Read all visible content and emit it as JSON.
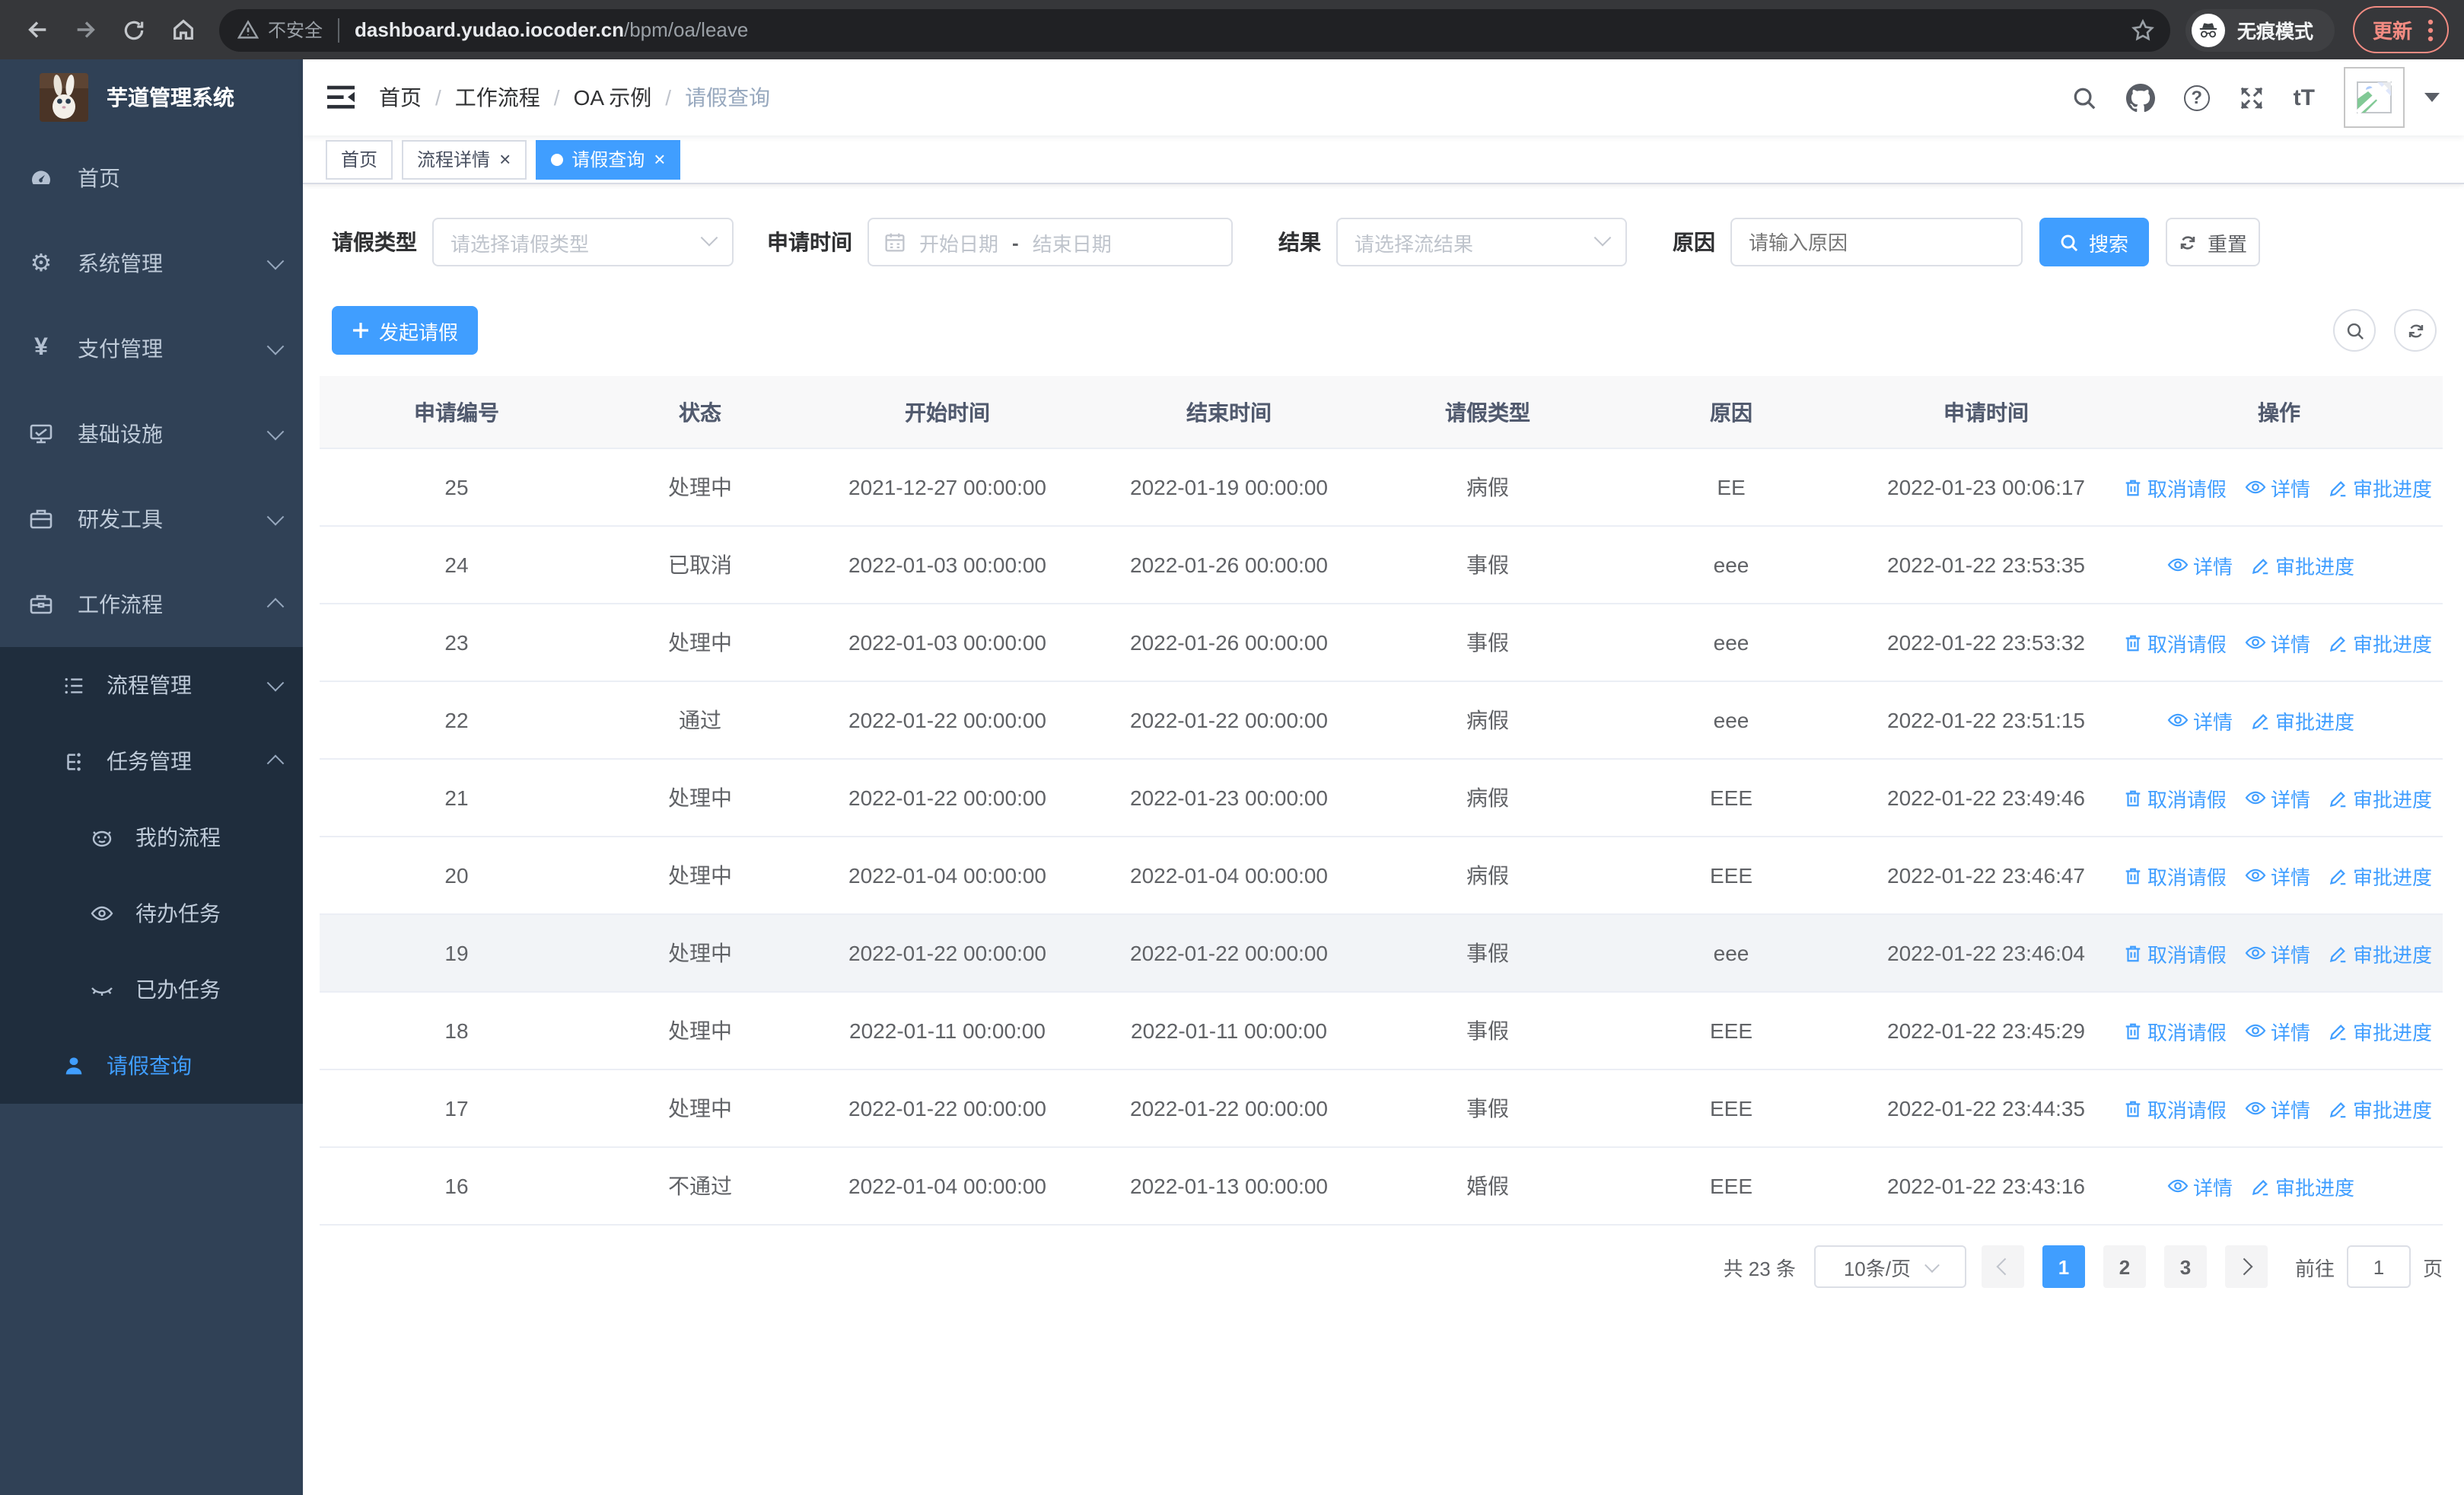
{
  "browser": {
    "security_label": "不安全",
    "url_host": "dashboard.yudao.iocoder.cn",
    "url_path": "/bpm/oa/leave",
    "incognito_label": "无痕模式",
    "update_label": "更新"
  },
  "sidebar": {
    "title": "芋道管理系统",
    "items": [
      {
        "label": "首页"
      },
      {
        "label": "系统管理"
      },
      {
        "label": "支付管理",
        "icon_text": "¥"
      },
      {
        "label": "基础设施"
      },
      {
        "label": "研发工具"
      },
      {
        "label": "工作流程"
      }
    ],
    "submenu": [
      {
        "label": "流程管理"
      },
      {
        "label": "任务管理"
      },
      {
        "label": "我的流程"
      },
      {
        "label": "待办任务"
      },
      {
        "label": "已办任务"
      },
      {
        "label": "请假查询"
      }
    ]
  },
  "navbar": {
    "breadcrumb": [
      "首页",
      "工作流程",
      "OA 示例",
      "请假查询"
    ],
    "sep": "/",
    "font_icon_text": "tT",
    "help_glyph": "?"
  },
  "tags": [
    {
      "label": "首页"
    },
    {
      "label": "流程详情"
    },
    {
      "label": "请假查询"
    }
  ],
  "ui": {
    "close_glyph": "×",
    "gear_glyph": "⚙"
  },
  "filters": {
    "leave_type_label": "请假类型",
    "leave_type_placeholder": "请选择请假类型",
    "apply_time_label": "申请时间",
    "date_start_placeholder": "开始日期",
    "date_separator": "-",
    "date_end_placeholder": "结束日期",
    "result_label": "结果",
    "result_placeholder": "请选择流结果",
    "reason_label": "原因",
    "reason_placeholder": "请输入原因",
    "search_label": "搜索",
    "reset_label": "重置"
  },
  "toolbar": {
    "create_label": "发起请假"
  },
  "table": {
    "columns": [
      "申请编号",
      "状态",
      "开始时间",
      "结束时间",
      "请假类型",
      "原因",
      "申请时间",
      "操作"
    ],
    "action_labels": {
      "cancel": "取消请假",
      "detail": "详情",
      "progress": "审批进度"
    },
    "rows": [
      {
        "id": "25",
        "status": "处理中",
        "start": "2021-12-27 00:00:00",
        "end": "2022-01-19 00:00:00",
        "type": "病假",
        "reason": "EE",
        "apply_time": "2022-01-23 00:06:17",
        "actions": [
          "cancel",
          "detail",
          "progress"
        ]
      },
      {
        "id": "24",
        "status": "已取消",
        "start": "2022-01-03 00:00:00",
        "end": "2022-01-26 00:00:00",
        "type": "事假",
        "reason": "eee",
        "apply_time": "2022-01-22 23:53:35",
        "actions": [
          "detail",
          "progress"
        ]
      },
      {
        "id": "23",
        "status": "处理中",
        "start": "2022-01-03 00:00:00",
        "end": "2022-01-26 00:00:00",
        "type": "事假",
        "reason": "eee",
        "apply_time": "2022-01-22 23:53:32",
        "actions": [
          "cancel",
          "detail",
          "progress"
        ]
      },
      {
        "id": "22",
        "status": "通过",
        "start": "2022-01-22 00:00:00",
        "end": "2022-01-22 00:00:00",
        "type": "病假",
        "reason": "eee",
        "apply_time": "2022-01-22 23:51:15",
        "actions": [
          "detail",
          "progress"
        ]
      },
      {
        "id": "21",
        "status": "处理中",
        "start": "2022-01-22 00:00:00",
        "end": "2022-01-23 00:00:00",
        "type": "病假",
        "reason": "EEE",
        "apply_time": "2022-01-22 23:49:46",
        "actions": [
          "cancel",
          "detail",
          "progress"
        ]
      },
      {
        "id": "20",
        "status": "处理中",
        "start": "2022-01-04 00:00:00",
        "end": "2022-01-04 00:00:00",
        "type": "病假",
        "reason": "EEE",
        "apply_time": "2022-01-22 23:46:47",
        "actions": [
          "cancel",
          "detail",
          "progress"
        ]
      },
      {
        "id": "19",
        "status": "处理中",
        "start": "2022-01-22 00:00:00",
        "end": "2022-01-22 00:00:00",
        "type": "事假",
        "reason": "eee",
        "apply_time": "2022-01-22 23:46:04",
        "actions": [
          "cancel",
          "detail",
          "progress"
        ],
        "highlighted": true
      },
      {
        "id": "18",
        "status": "处理中",
        "start": "2022-01-11 00:00:00",
        "end": "2022-01-11 00:00:00",
        "type": "事假",
        "reason": "EEE",
        "apply_time": "2022-01-22 23:45:29",
        "actions": [
          "cancel",
          "detail",
          "progress"
        ]
      },
      {
        "id": "17",
        "status": "处理中",
        "start": "2022-01-22 00:00:00",
        "end": "2022-01-22 00:00:00",
        "type": "事假",
        "reason": "EEE",
        "apply_time": "2022-01-22 23:44:35",
        "actions": [
          "cancel",
          "detail",
          "progress"
        ]
      },
      {
        "id": "16",
        "status": "不通过",
        "start": "2022-01-04 00:00:00",
        "end": "2022-01-13 00:00:00",
        "type": "婚假",
        "reason": "EEE",
        "apply_time": "2022-01-22 23:43:16",
        "actions": [
          "detail",
          "progress"
        ]
      }
    ]
  },
  "pagination": {
    "total_text": "共 23 条",
    "page_size_text": "10条/页",
    "pages": [
      "1",
      "2",
      "3"
    ],
    "active_page": "1",
    "goto_label": "前往",
    "goto_value": "1",
    "goto_suffix_label": "页"
  },
  "colors": {
    "accent": "#409eff",
    "sidebar_bg": "#304156",
    "submenu_bg": "#1f2d3d"
  }
}
